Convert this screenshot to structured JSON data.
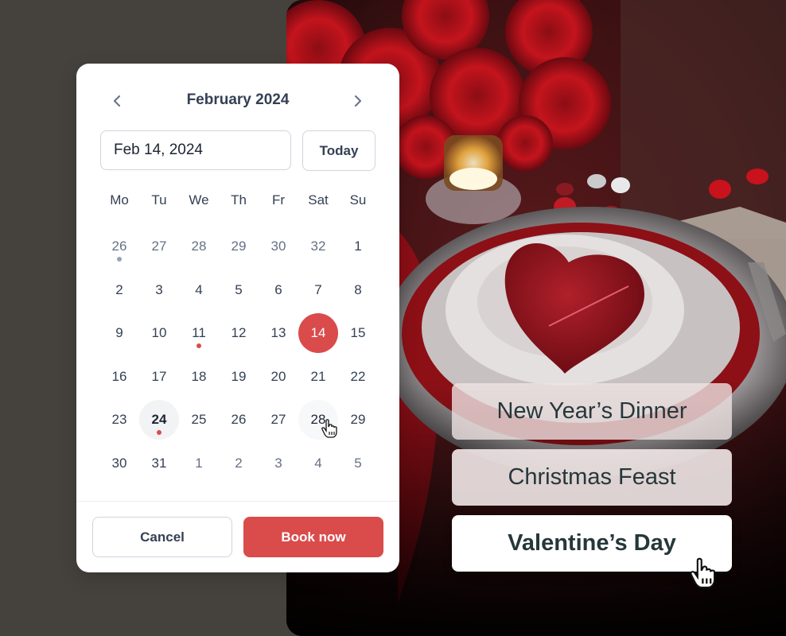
{
  "calendar": {
    "month_title": "February 2024",
    "prev_icon": "chevron-left-icon",
    "next_icon": "chevron-right-icon",
    "date_input_value": "Feb 14, 2024",
    "today_label": "Today",
    "weekdays": [
      "Mo",
      "Tu",
      "We",
      "Th",
      "Fr",
      "Sat",
      "Su"
    ],
    "days": [
      {
        "label": "26",
        "state": "muted",
        "dot": "gray"
      },
      {
        "label": "27",
        "state": "muted"
      },
      {
        "label": "28",
        "state": "muted"
      },
      {
        "label": "29",
        "state": "muted"
      },
      {
        "label": "30",
        "state": "muted"
      },
      {
        "label": "32",
        "state": "muted"
      },
      {
        "label": "1"
      },
      {
        "label": "2"
      },
      {
        "label": "3"
      },
      {
        "label": "4"
      },
      {
        "label": "5"
      },
      {
        "label": "6"
      },
      {
        "label": "7"
      },
      {
        "label": "8"
      },
      {
        "label": "9"
      },
      {
        "label": "10"
      },
      {
        "label": "11",
        "dot": "red"
      },
      {
        "label": "12"
      },
      {
        "label": "13"
      },
      {
        "label": "14",
        "state": "selected"
      },
      {
        "label": "15"
      },
      {
        "label": "16"
      },
      {
        "label": "17"
      },
      {
        "label": "18"
      },
      {
        "label": "19"
      },
      {
        "label": "20"
      },
      {
        "label": "21"
      },
      {
        "label": "22"
      },
      {
        "label": "23"
      },
      {
        "label": "24",
        "state": "today",
        "dot": "red"
      },
      {
        "label": "25"
      },
      {
        "label": "26"
      },
      {
        "label": "27"
      },
      {
        "label": "28",
        "state": "hover"
      },
      {
        "label": "29"
      },
      {
        "label": "30"
      },
      {
        "label": "31"
      },
      {
        "label": "1",
        "state": "muted"
      },
      {
        "label": "2",
        "state": "muted"
      },
      {
        "label": "3",
        "state": "muted"
      },
      {
        "label": "4",
        "state": "muted"
      },
      {
        "label": "5",
        "state": "muted"
      }
    ],
    "cancel_label": "Cancel",
    "book_label": "Book now"
  },
  "options": [
    {
      "label": "New Year’s Dinner"
    },
    {
      "label": "Christmas Feast"
    },
    {
      "label": "Valentine’s Day",
      "active": true
    }
  ],
  "colors": {
    "accent": "#da4b4b",
    "text": "#344054",
    "background": "#45423d"
  }
}
